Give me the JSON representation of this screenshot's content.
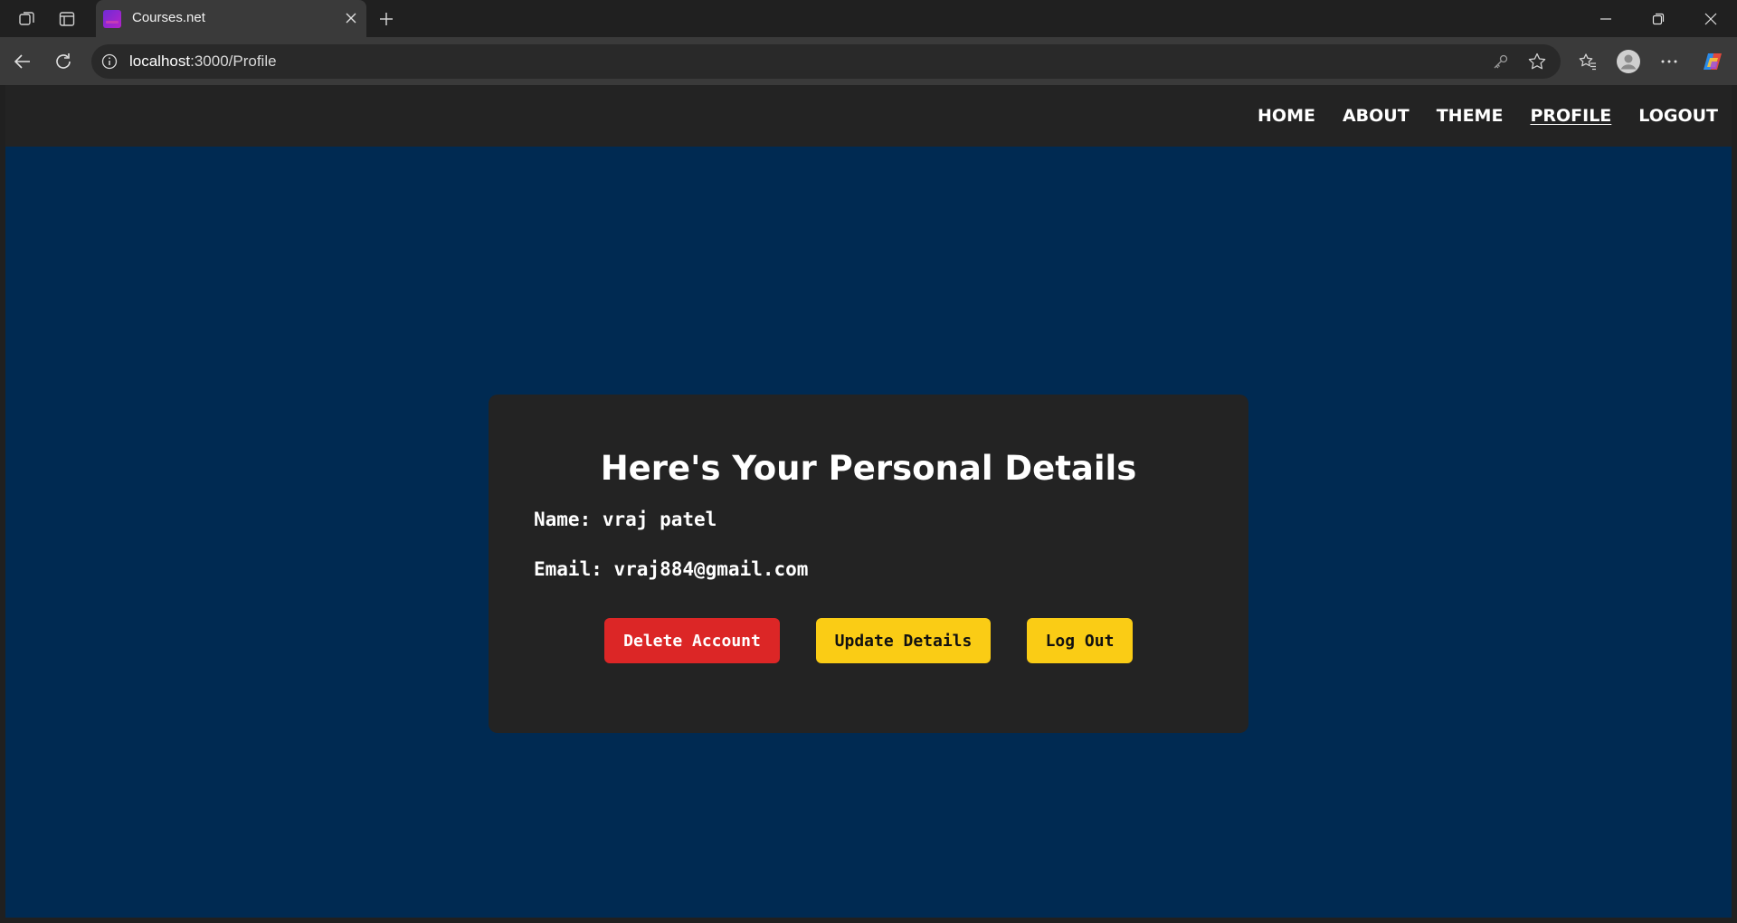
{
  "browser": {
    "tab": {
      "title": "Courses.net"
    },
    "address": {
      "host": "localhost",
      "path": ":3000/Profile"
    }
  },
  "site": {
    "nav": [
      {
        "label": "HOME",
        "active": false
      },
      {
        "label": "ABOUT",
        "active": false
      },
      {
        "label": "THEME",
        "active": false
      },
      {
        "label": "PROFILE",
        "active": true
      },
      {
        "label": "LOGOUT",
        "active": false
      }
    ]
  },
  "profile": {
    "title": "Here's Your Personal Details",
    "name_line": "Name: vraj patel",
    "email_line": "Email: vraj884@gmail.com",
    "buttons": {
      "delete": "Delete Account",
      "update": "Update Details",
      "logout": "Log Out"
    }
  },
  "colors": {
    "page_bg": "#002a52",
    "nav_bg": "#232323",
    "card_bg": "#232323",
    "danger": "#dc2626",
    "warning": "#facc15"
  },
  "icons": {
    "workspaces": "workspaces-icon",
    "tab_actions": "tab-actions-icon",
    "new_tab": "plus-icon",
    "back": "back-arrow-icon",
    "refresh": "refresh-icon",
    "site_info": "info-icon",
    "password": "key-icon",
    "favorite": "star-icon",
    "favorites": "favorites-icon",
    "profile": "user-avatar-icon",
    "more": "more-icon",
    "copilot": "copilot-icon"
  }
}
